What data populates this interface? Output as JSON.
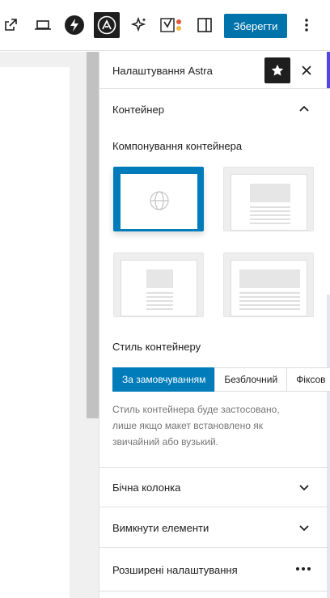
{
  "toolbar": {
    "save_label": "Зберегти",
    "icons": [
      "external-link-icon",
      "desktop-preview-icon",
      "spectra-bolt-icon",
      "astra-icon",
      "sparkle-icon",
      "yoast-icon",
      "sidebar-toggle-icon",
      "more-options-icon"
    ]
  },
  "sidebar": {
    "title": "Налаштування Astra",
    "container": {
      "title": "Контейнер",
      "layout_label": "Компонування контейнера",
      "style_label": "Стиль контейнеру",
      "style_options": [
        "За замовчуванням",
        "Безблочний",
        "Фіксов"
      ],
      "style_selected": "За замовчуванням",
      "help": "Стиль контейнера буде застосовано, лише якщо макет встановлено як звичайний або вузький."
    },
    "panels": [
      {
        "title": "Бічна колонка"
      },
      {
        "title": "Вимкнути елементи"
      },
      {
        "title": "Розширені налаштування"
      }
    ]
  },
  "colors": {
    "accent": "#007cba",
    "save": "#0073aa",
    "dark": "#1e1e1e"
  }
}
